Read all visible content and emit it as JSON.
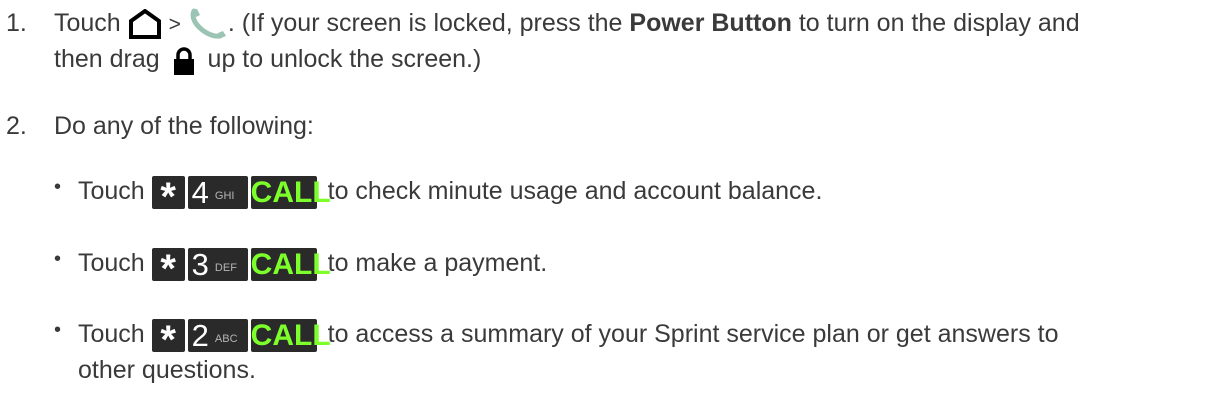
{
  "steps": [
    {
      "number": "1.",
      "pre": "Touch",
      "gt": ">",
      "after_phone": ". (If your screen is locked, press the",
      "bold": "Power Button",
      "after_bold": "to turn on the display and",
      "line2_pre": "then drag",
      "line2_post": "up to unlock the screen.)",
      "icons": [
        "home-icon",
        "phone-icon",
        "lock-icon"
      ]
    },
    {
      "number": "2.",
      "text": "Do any of the following:"
    }
  ],
  "keys": {
    "star": "*",
    "call": "CALL",
    "digit_4": "4",
    "letters_4": "GHI",
    "digit_3": "3",
    "letters_3": "DEF",
    "digit_2": "2",
    "letters_2": "ABC"
  },
  "bullets": [
    {
      "pre": "Touch",
      "text": "to check minute usage and account balance."
    },
    {
      "pre": "Touch",
      "text": "to make a payment."
    },
    {
      "pre": "Touch",
      "text": "to access a summary of your Sprint service plan or get answers to",
      "text_cont": "other questions."
    }
  ],
  "colors": {
    "text": "#3a3a3a",
    "key_bg": "#2a2a2a",
    "call_green": "#7cff2a"
  }
}
